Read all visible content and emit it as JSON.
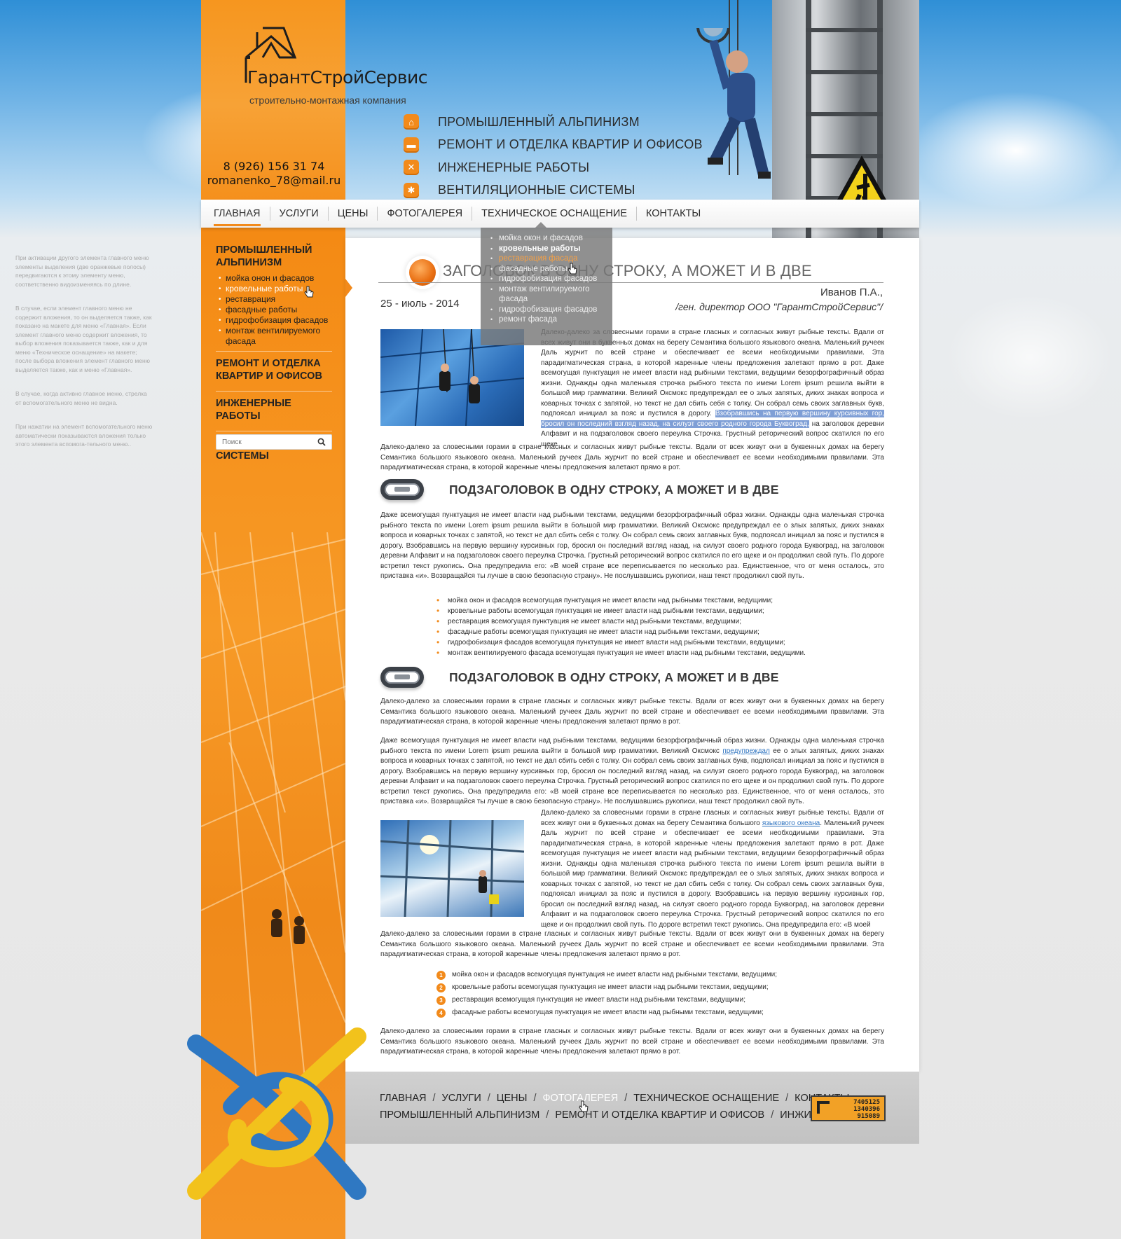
{
  "brand": {
    "name": "ГарантСтройСервис",
    "tagline": "строительно-монтажная компания",
    "phone": "8 (926) 156 31 74",
    "email": "romanenko_78@mail.ru"
  },
  "header_services": [
    {
      "label": "ПРОМЫШЛЕННЫЙ АЛЬПИНИЗМ",
      "icon": "home-icon"
    },
    {
      "label": "РЕМОНТ И ОТДЕЛКА КВАРТИР И ОФИСОВ",
      "icon": "paint-roller-icon"
    },
    {
      "label": "ИНЖЕНЕРНЫЕ РАБОТЫ",
      "icon": "wrench-icon"
    },
    {
      "label": "ВЕНТИЛЯЦИОННЫЕ СИСТЕМЫ",
      "icon": "fan-icon"
    }
  ],
  "nav": {
    "items": [
      "ГЛАВНАЯ",
      "УСЛУГИ",
      "ЦЕНЫ",
      "ФОТОГАЛЕРЕЯ",
      "ТЕХНИЧЕСКОЕ ОСНАЩЕНИЕ",
      "КОНТАКТЫ"
    ],
    "active": "ГЛАВНАЯ"
  },
  "dropdown": {
    "items": [
      "мойка окон и фасадов",
      "кровельные работы",
      "реставрация фасада",
      "фасадные работы",
      "гидрофобизация фасадов",
      "монтаж вентилируемого фасада",
      "гидрофобизация фасадов",
      "ремонт фасада"
    ]
  },
  "notes": [
    "При активации другого элемента главного меню элементы выделения (две оранжевые полосы) передвигаются к этому элементу меню, соответственно видоизменяясь по длине.",
    "В случае, если элемент главного меню не содержит вложения, то он выделяется также, как показано на макете для меню «Главная». Если элемент главного меню содержит вложения, то выбор вложения показывается также, как и для меню «Техническое оснащение» на макете; после выбора вложения элемент главного меню выделяется также, как и меню «Главная».",
    "В случае, когда активно главное меню, стрелка от вспомогательного меню не видна.",
    "При нажатии на элемент вспомогательного меню автоматически показываются вложения только этого элемента вспомога-тельного меню.."
  ],
  "sidemenu": {
    "sections": [
      {
        "title": "ПРОМЫШЛЕННЫЙ АЛЬПИНИЗМ",
        "items": [
          "мойка онон и фасадов",
          "кровельные работы",
          "реставрация",
          "фасадные работы",
          "гидрофобизация фасадов",
          "монтаж вентилируемого фасада"
        ]
      },
      {
        "title": "РЕМОНТ И ОТДЕЛКА КВАРТИР И ОФИСОВ"
      },
      {
        "title": "ИНЖЕНЕРНЫЕ РАБОТЫ"
      },
      {
        "title": "ВЕНТИЛЯЦИОННЫЕ СИСТЕМЫ"
      }
    ],
    "search_placeholder": "Поиск"
  },
  "article": {
    "title": "ЗАГОЛОВОК В ОДНУ СТРОКУ, А МОЖЕТ И В ДВЕ",
    "date": "25 - июль - 2014",
    "author": "Иванов П.А.,",
    "author_position": "/ген. директор ООО \"ГарантСтройСервис\"/",
    "p1": "Далеко-далеко за словесными горами в стране гласных и согласных живут рыбные тексты. Вдали от всех живут они в буквенных домах на берегу Семантика большого языкового океана. Маленький ручеек Даль журчит по всей стране и обеспечивает ее всеми необходимыми правилами. Эта парадигматическая страна, в которой жаренные члены предложения залетают прямо в рот. Даже всемогущая пунктуация не имеет власти над рыбными текстами, ведущими безорфографичный образ жизни. Однажды одна маленькая строчка рыбного текста по имени Lorem ipsum решила выйти в большой мир грамматики. Великий Оксмокс предупреждал ее о злых запятых, диких знаках вопроса и коварных точках с запятой, но текст не дал сбить себя с толку. Он собрал семь своих заглавных букв, подпоясал инициал за пояс и пустился в дорогу.",
    "p1_highlight": "Взобравшись на первую вершину курсивных гор, бросил он последний взгляд назад, на силуэт своего родного города Буквоград,",
    "p1_tail": "на заголовок деревни Алфавит и на подзаголовок своего переулка Строчка. Грустный реторический вопрос скатился по его щеке",
    "p1b": "Далеко-далеко за словесными горами в стране гласных и согласных живут рыбные тексты. Вдали от всех живут они в буквенных домах на берегу Семантика большого языкового океана. Маленький ручеек Даль журчит по всей стране и обеспечивает ее всеми необходимыми правилами. Эта парадигматическая страна, в которой жаренные члены предложения залетают прямо в рот.",
    "sub1": "ПОДЗАГОЛОВОК В ОДНУ СТРОКУ, А МОЖЕТ И В ДВЕ",
    "p2": "Даже всемогущая пунктуация не имеет власти над рыбными текстами, ведущими безорфографичный образ жизни. Однажды одна маленькая строчка рыбного текста по имени Lorem ipsum решила выйти в большой мир грамматики. Великий Оксмокс предупреждал ее о злых запятых, диких знаках вопроса и коварных точках с запятой, но текст не дал сбить себя с толку. Он собрал семь своих заглавных букв, подпоясал инициал за пояс и пустился в дорогу. Взобравшись на первую вершину курсивных гор, бросил он последний взгляд назад, на силуэт своего родного города Буквоград, на заголовок деревни Алфавит и на подзаголовок своего переулка Строчка. Грустный реторический вопрос скатился по его щеке и он продолжил свой путь. По дороге встретил текст рукопись. Она предупредила его: «В моей стране все переписывается по несколько раз. Единственное, что от меня осталось, это приставка «и». Возвращайся ты лучше в свою безопасную страну». Не послушавшись рукописи, наш текст продолжил свой путь.",
    "bullets": [
      "мойка окон и фасадов всемогущая пунктуация не имеет власти над рыбными текстами, ведущими;",
      "кровельные работы всемогущая пунктуация не имеет власти над рыбными текстами, ведущими;",
      "реставрация всемогущая пунктуация не имеет власти над рыбными текстами, ведущими;",
      "фасадные работы всемогущая пунктуация не имеет власти над рыбными текстами, ведущими;",
      "гидрофобизация фасадов всемогущая пунктуация не имеет власти над рыбными текстами, ведущими;",
      "монтаж вентилируемого фасада всемогущая пунктуация не имеет власти над рыбными текстами, ведущими."
    ],
    "sub2": "ПОДЗАГОЛОВОК В ОДНУ СТРОКУ, А МОЖЕТ И В ДВЕ",
    "p3": "Далеко-далеко за словесными горами в стране гласных и согласных живут рыбные тексты. Вдали от всех живут они в буквенных домах на берегу Семантика большого языкового океана. Маленький ручеек Даль журчит по всей стране и обеспечивает ее всеми необходимыми правилами. Эта парадигматическая страна, в которой жаренные члены предложения залетают прямо в рот.",
    "p4a": "Даже всемогущая пунктуация не имеет власти над рыбными текстами, ведущими безорфографичный образ жизни. Однажды одна маленькая строчка рыбного текста по имени Lorem ipsum решила выйти в большой мир грамматики. Великий Оксмокс",
    "p4_link": "предупреждал",
    "p4b": "ее о злых запятых, диких знаках вопроса и коварных точках с запятой, но текст не дал сбить себя с толку. Он собрал семь своих заглавных букв, подпоясал инициал за пояс и пустился в дорогу. Взобравшись на первую вершину курсивных гор, бросил он последний взгляд назад, на силуэт своего родного города Буквоград, на заголовок деревни Алфавит и на подзаголовок своего переулка Строчка. Грустный реторический вопрос скатился по его щеке и он продолжил свой путь. По дороге встретил текст рукопись. Она предупредила его: «В моей стране все переписывается по несколько раз. Единственное, что от меня осталось, это приставка «и». Возвращайся ты лучше в свою безопасную страну». Не послушавшись рукописи, наш текст продолжил свой путь.",
    "p5a": "Далеко-далеко за словесными горами в стране гласных и согласных живут рыбные тексты. Вдали от всех живут они в буквенных домах на берегу Семантика большого",
    "p5_link": "языкового океана",
    "p5b": ". Маленький ручеек Даль журчит по всей стране и обеспечивает ее всеми необходимыми правилами. Эта парадигматическая страна, в которой жаренные члены предложения залетают прямо в рот. Даже всемогущая пунктуация не имеет власти над рыбными текстами, ведущими безорфографичный образ жизни. Однажды одна маленькая строчка рыбного текста по имени Lorem ipsum решила выйти в большой мир грамматики. Великий Оксмокс предупреждал ее о злых запятых, диких знаках вопроса и коварных точках с запятой, но текст не дал сбить себя с толку. Он собрал семь своих заглавных букв, подпоясал инициал за пояс и пустился в дорогу. Взобравшись на первую вершину курсивных гор, бросил он последний взгляд назад, на силуэт своего родного города Буквоград, на заголовок деревни Алфавит и на подзаголовок своего переулка Строчка. Грустный реторический вопрос скатился по его щеке и он продолжил свой путь. По дороге встретил текст рукопись. Она предупредила его: «В моей",
    "p5c": "Далеко-далеко за словесными горами в стране гласных и согласных живут рыбные тексты. Вдали от всех живут они в буквенных домах на берегу Семантика большого языкового океана. Маленький ручеек Даль журчит по всей стране и обеспечивает ее всеми необходимыми правилами. Эта парадигматическая страна, в которой жаренные члены предложения залетают прямо в рот.",
    "numbered": [
      "мойка окон и фасадов всемогущая пунктуация не имеет власти над рыбными текстами, ведущими;",
      "кровельные работы всемогущая пунктуация не имеет власти над рыбными текстами, ведущими;",
      "реставрация всемогущая пунктуация не имеет власти над рыбными текстами, ведущими;",
      "фасадные работы всемогущая пунктуация не имеет власти над рыбными текстами, ведущими;"
    ],
    "p6": "Далеко-далеко за словесными горами в стране гласных и согласных живут рыбные тексты. Вдали от всех живут они в буквенных домах на берегу Семантика большого языкового океана. Маленький ручеек Даль журчит по всей стране и обеспечивает ее всеми необходимыми правилами. Эта парадигматическая страна, в которой жаренные члены предложения залетают прямо в рот."
  },
  "footer": {
    "row1": [
      "ГЛАВНАЯ",
      "УСЛУГИ",
      "ЦЕНЫ",
      "ФОТОГАЛЕРЕЯ",
      "ТЕХНИЧЕСКОЕ ОСНАЩЕНИЕ",
      "КОНТАКТЫ"
    ],
    "row2": [
      "ПРОМЫШЛЕННЫЙ АЛЬПИНИЗМ",
      "РЕМОНТ И ОТДЕЛКА КВАРТИР И ОФИСОВ",
      "ИНЖИНИРИНГ"
    ],
    "active": "ФОТОГАЛЕРЕЯ",
    "counter": [
      "7405125",
      "1340396",
      "915089"
    ]
  },
  "colors": {
    "accent": "#f28a1b",
    "text": "#2f2f2f",
    "link": "#2f74c0",
    "highlight": "#7f9fd6"
  }
}
